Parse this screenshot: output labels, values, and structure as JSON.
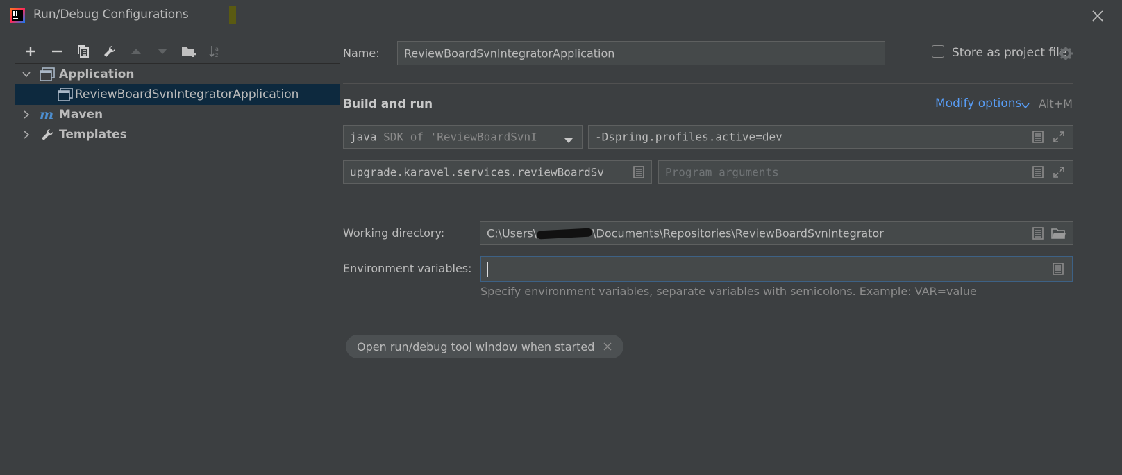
{
  "window": {
    "title": "Run/Debug Configurations"
  },
  "toolbar": {
    "icons": [
      "plus-icon",
      "minus-icon",
      "copy-icon",
      "wrench-icon",
      "arrow-up-icon",
      "arrow-down-icon",
      "new-folder-icon",
      "sort-alpha-icon"
    ]
  },
  "tree": {
    "items": [
      {
        "label": "Application",
        "expanded": true,
        "icon": "application-icon"
      },
      {
        "label": "ReviewBoardSvnIntegratorApplication",
        "selected": true,
        "icon": "application-config-icon"
      },
      {
        "label": "Maven",
        "expanded": false,
        "icon": "maven-icon"
      },
      {
        "label": "Templates",
        "expanded": false,
        "icon": "wrench-icon"
      }
    ]
  },
  "form": {
    "name_label": "Name:",
    "name_value": "ReviewBoardSvnIntegratorApplication",
    "store_label": "Store as project file",
    "section_title": "Build and run",
    "modify_options": "Modify options",
    "modify_shortcut": "Alt+M",
    "jre_java": "java",
    "jre_sdk": "SDK of 'ReviewBoardSvnI",
    "vm_options": "-Dspring.profiles.active=dev",
    "main_class": "upgrade.karavel.services.reviewBoardSv",
    "program_args_placeholder": "Program arguments",
    "workdir_label": "Working directory:",
    "workdir_prefix": "C:\\Users\\",
    "workdir_suffix": "\\Documents\\Repositories\\ReviewBoardSvnIntegrator",
    "env_label": "Environment variables:",
    "env_value": "",
    "env_hint": "Specify environment variables, separate variables with semicolons. Example: VAR=value",
    "chip_label": "Open run/debug tool window when started"
  },
  "colors": {
    "background": "#3c3f41",
    "field": "#45494a",
    "selection": "#0d293e",
    "link": "#589df6",
    "focus": "#3d6185"
  }
}
